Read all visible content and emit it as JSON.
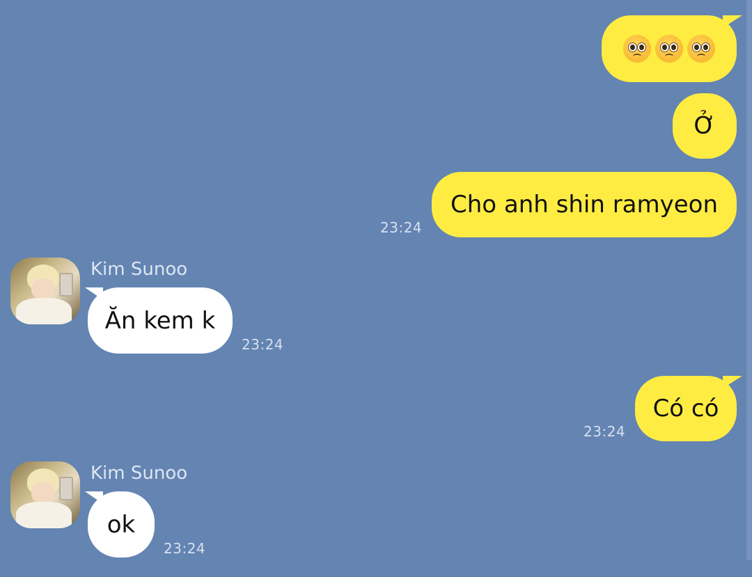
{
  "messages": [
    {
      "direction": "outgoing",
      "emoji": [
        "pleading-face",
        "pleading-face",
        "pleading-face"
      ]
    },
    {
      "direction": "outgoing",
      "text": "Ở"
    },
    {
      "direction": "outgoing",
      "text": "Cho anh shin ramyeon",
      "time": "23:24"
    },
    {
      "direction": "incoming",
      "sender": "Kim Sunoo",
      "text": "Ăn kem k",
      "time": "23:24"
    },
    {
      "direction": "outgoing",
      "text": "Có có",
      "time": "23:24"
    },
    {
      "direction": "incoming",
      "sender": "Kim Sunoo",
      "text": "ok",
      "time": "23:24"
    }
  ],
  "colors": {
    "background": "#6484b2",
    "outgoing_bubble": "#ffec42",
    "incoming_bubble": "#ffffff",
    "meta_text": "#d7e1ef"
  }
}
